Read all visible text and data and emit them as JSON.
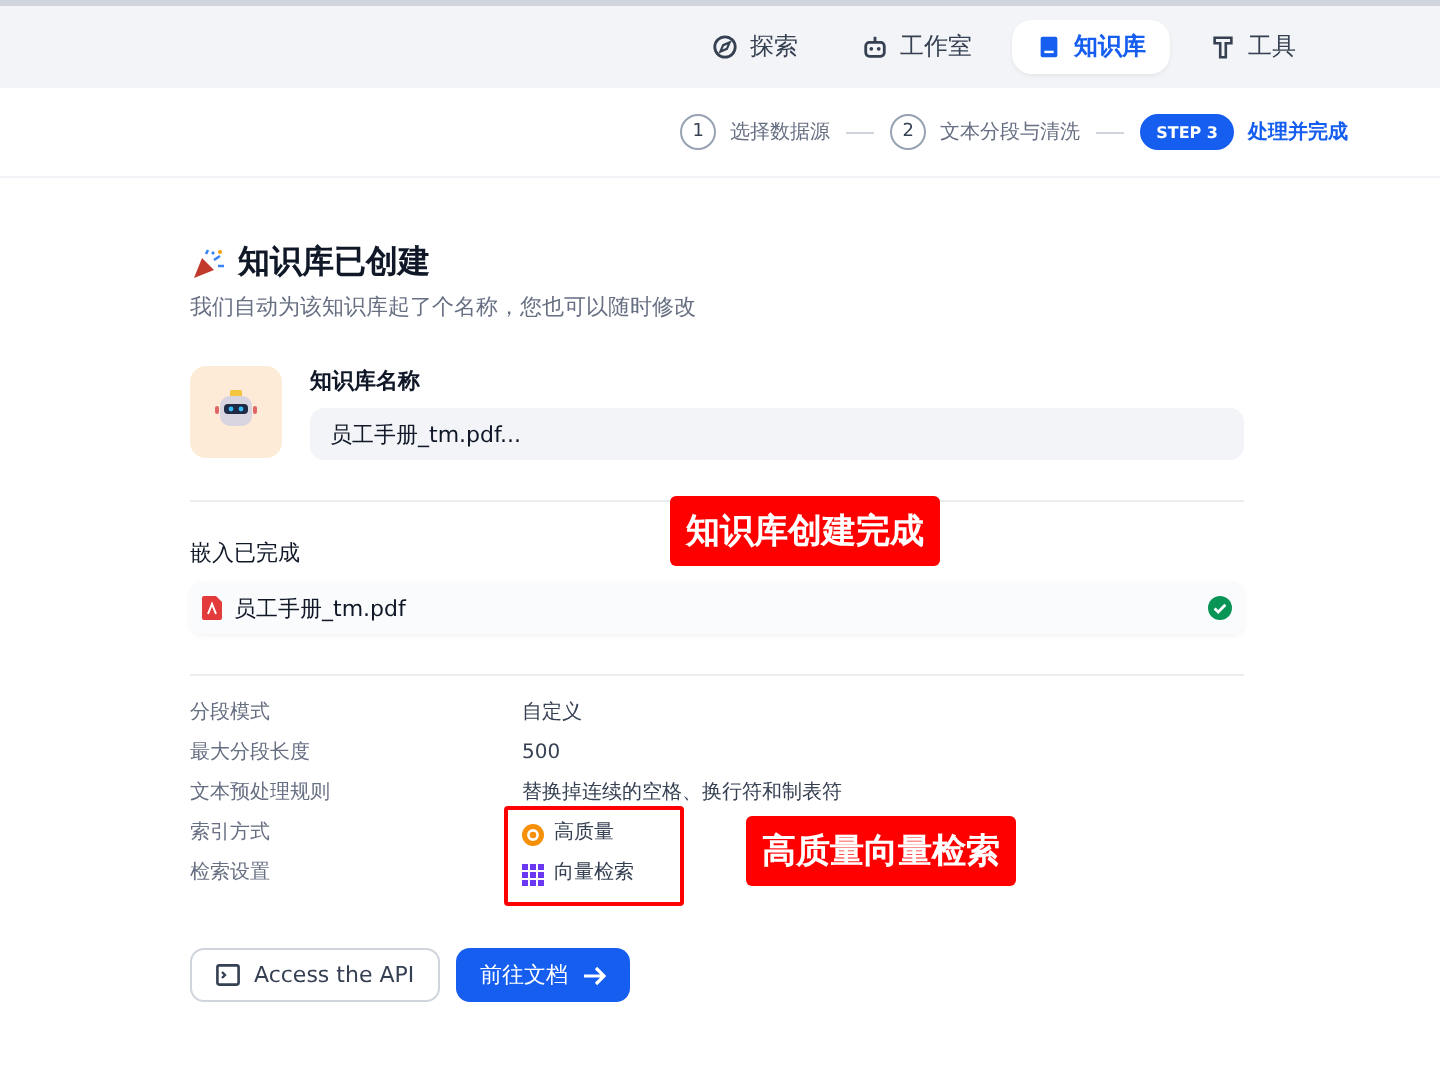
{
  "nav": [
    {
      "label": "探索",
      "kind": "explore",
      "selected": false
    },
    {
      "label": "工作室",
      "kind": "studio",
      "selected": false
    },
    {
      "label": "知识库",
      "kind": "knowledge",
      "selected": true
    },
    {
      "label": "工具",
      "kind": "tools",
      "selected": false
    }
  ],
  "steps": [
    {
      "badge": "1",
      "label": "选择数据源",
      "selected": false
    },
    {
      "badge": "2",
      "label": "文本分段与清洗",
      "selected": false
    },
    {
      "badge": "STEP 3",
      "label": "处理并完成",
      "selected": true
    }
  ],
  "heading": {
    "title": "知识库已创建",
    "subtitle": "我们自动为该知识库起了个名称，您也可以随时修改"
  },
  "name_field": {
    "label": "知识库名称",
    "value": "员工手册_tm.pdf..."
  },
  "embedding": {
    "title": "嵌入已完成",
    "files": [
      {
        "name": "员工手册_tm.pdf",
        "done": true
      }
    ]
  },
  "settings": [
    {
      "label": "分段模式",
      "value": "自定义"
    },
    {
      "label": "最大分段长度",
      "value": "500"
    },
    {
      "label": "文本预处理规则",
      "value": "替换掉连续的空格、换行符和制表符"
    },
    {
      "label": "索引方式",
      "value": "高质量",
      "kind": "quality"
    },
    {
      "label": "检索设置",
      "value": "向量检索",
      "kind": "vector"
    }
  ],
  "buttons": [
    {
      "label": "Access the API",
      "kind": "secondary"
    },
    {
      "label": "前往文档",
      "kind": "primary"
    }
  ],
  "annotations": [
    {
      "text": "知识库创建完成",
      "kind": "label-top"
    },
    {
      "text": "高质量向量检索",
      "kind": "label-bottom"
    }
  ]
}
